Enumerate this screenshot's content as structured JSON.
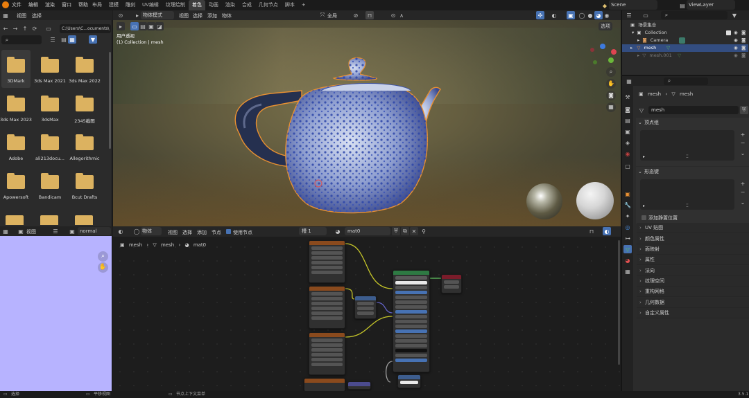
{
  "topbar": {
    "menus": [
      "文件",
      "编辑",
      "渲染",
      "窗口",
      "帮助"
    ],
    "workspaces": [
      "布局",
      "建模",
      "雕刻",
      "UV编辑",
      "纹理绘制",
      "着色",
      "动画",
      "渲染",
      "合成",
      "几何节点",
      "脚本"
    ],
    "active_workspace": "着色",
    "scene": "Scene",
    "view_layer": "ViewLayer"
  },
  "file_browser": {
    "menus": [
      "视图",
      "选择"
    ],
    "path": "C:\\Users\\C...ocuments\\",
    "items": [
      "3DMark",
      "3ds Max 2021",
      "3ds Max 2022",
      "3ds Max 2023",
      "3dsMax",
      "2345截图",
      "Adobe",
      "ali213docu...",
      "Allegorithmic",
      "Apowersoft",
      "Bandicam",
      "Bcut Drafts"
    ],
    "selected_item": "3DMark"
  },
  "viewport": {
    "mode": "物体模式",
    "menus": [
      "视图",
      "选择",
      "添加",
      "物体"
    ],
    "transform": "全局",
    "view_label": "用户透视",
    "collection_label": "(1) Collection | mesh",
    "options_label": "选项"
  },
  "image_editor": {
    "menus": [
      "视图"
    ],
    "image_name": "normal"
  },
  "node_editor": {
    "object_menu": "物体",
    "menus": [
      "视图",
      "选择",
      "添加",
      "节点"
    ],
    "use_nodes": "使用节点",
    "slot": "槽 1",
    "material": "mat0",
    "breadcrumb": [
      "mesh",
      "mesh",
      "mat0"
    ]
  },
  "outliner": {
    "root": "场景集合",
    "items": [
      "Collection",
      "Camera",
      "mesh",
      "mesh.001"
    ],
    "selected": "mesh"
  },
  "properties": {
    "breadcrumb": [
      "mesh",
      "mesh"
    ],
    "data_name": "mesh",
    "panels_open": [
      "顶点组",
      "形态键"
    ],
    "relative_label": "添加静置位置",
    "panels": [
      "UV 贴图",
      "颜色属性",
      "面映射",
      "属性",
      "法向",
      "纹理空间",
      "重构网格",
      "几何数据",
      "自定义属性"
    ]
  },
  "statusbar": {
    "left": "选择",
    "mid1": "平移视图",
    "mid2": "节点上下文菜单",
    "version": "3.5.1"
  },
  "colors": {
    "accent": "#4772b3",
    "selection_outline": "#e89032",
    "folder": "#dcb260",
    "image_bg": "#b7b3ff",
    "principled_header": "#2e7a43",
    "texture_header": "#8a4a1d"
  }
}
